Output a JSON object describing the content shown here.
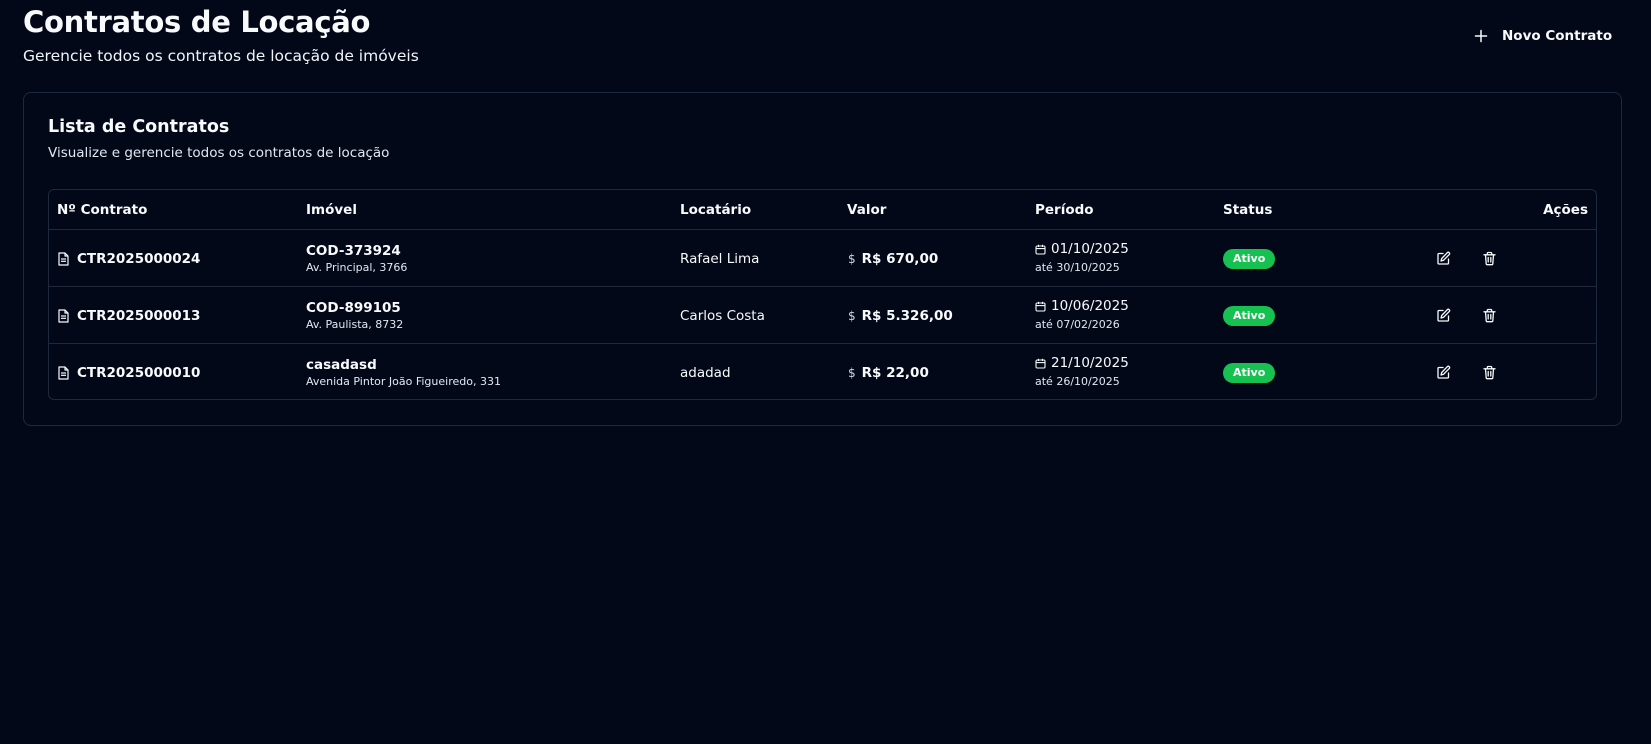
{
  "header": {
    "title": "Contratos de Locação",
    "subtitle": "Gerencie todos os contratos de locação de imóveis",
    "new_button_label": "Novo Contrato"
  },
  "card": {
    "title": "Lista de Contratos",
    "description": "Visualize e gerencie todos os contratos de locação"
  },
  "table": {
    "columns": {
      "contract": "Nº Contrato",
      "property": "Imóvel",
      "tenant": "Locatário",
      "value": "Valor",
      "period": "Período",
      "status": "Status",
      "actions": "Ações"
    },
    "rows": [
      {
        "contract": "CTR2025000024",
        "property_code": "COD-373924",
        "property_address": "Av. Principal, 3766",
        "tenant": "Rafael Lima",
        "value_symbol": "$",
        "value": "R$ 670,00",
        "start": "01/10/2025",
        "end": "até 30/10/2025",
        "status": "Ativo"
      },
      {
        "contract": "CTR2025000013",
        "property_code": "COD-899105",
        "property_address": "Av. Paulista, 8732",
        "tenant": "Carlos Costa",
        "value_symbol": "$",
        "value": "R$ 5.326,00",
        "start": "10/06/2025",
        "end": "até 07/02/2026",
        "status": "Ativo"
      },
      {
        "contract": "CTR2025000010",
        "property_code": "casadasd",
        "property_address": "Avenida Pintor João Figueiredo, 331",
        "tenant": "adadad",
        "value_symbol": "$",
        "value": "R$ 22,00",
        "start": "21/10/2025",
        "end": "até 26/10/2025",
        "status": "Ativo"
      }
    ]
  },
  "colors": {
    "background": "#020817",
    "border": "#1e293b",
    "status_active": "#16c152",
    "text": "#f8fafc"
  },
  "icons": {
    "new": "plus-icon",
    "contract": "file-text-icon",
    "period": "calendar-icon",
    "edit": "edit-icon",
    "delete": "trash-icon"
  }
}
